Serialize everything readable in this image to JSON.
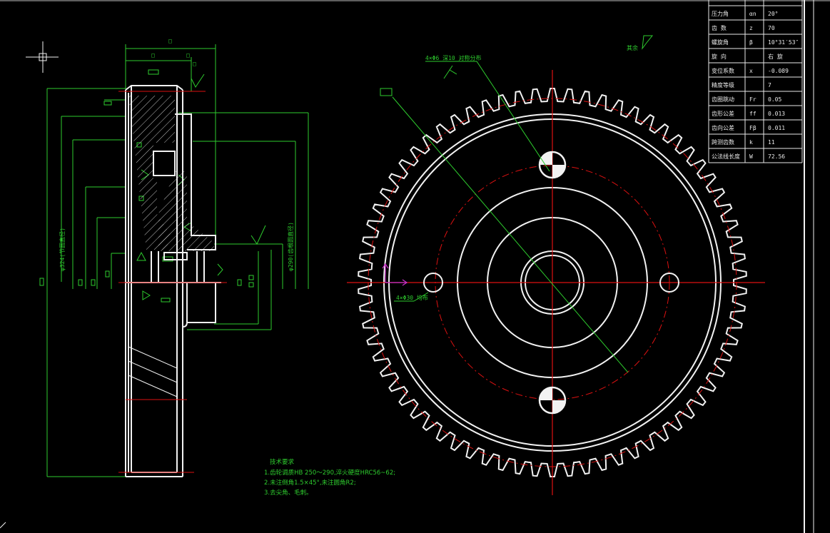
{
  "parameters": [
    {
      "name": "压力角",
      "symbol": "αn",
      "value": "20°"
    },
    {
      "name": "齿 数",
      "symbol": "z",
      "value": "70"
    },
    {
      "name": "螺旋角",
      "symbol": "β",
      "value": "10°31′53″"
    },
    {
      "name": "旋 向",
      "symbol": "",
      "value": "右 旋"
    },
    {
      "name": "变位系数",
      "symbol": "x",
      "value": "-0.089"
    },
    {
      "name": "精度等级",
      "symbol": "",
      "value": "7"
    },
    {
      "name": "齿圈跳动",
      "symbol": "Fr",
      "value": "0.05"
    },
    {
      "name": "齿形公差",
      "symbol": "ff",
      "value": "0.013"
    },
    {
      "name": "齿向公差",
      "symbol": "Fβ",
      "value": "0.011"
    },
    {
      "name": "跨测齿数",
      "symbol": "k",
      "value": "11"
    },
    {
      "name": "公法线长度",
      "symbol": "W",
      "value": "72.56"
    }
  ],
  "notes": {
    "title": "技术要求",
    "items": [
      "1.齿轮调质HB 250～290,淬火硬度HRC56~62;",
      "2.未注倒角1.5×45°,未注圆角R2;",
      "3.去尖角、毛刺。"
    ]
  },
  "labels": {
    "surface_other": "其余",
    "hole_note": "4×Φ30 均布",
    "leader_note": "4×Φ6 深10 对称分布",
    "dim_a": "φ324(节圆直径)",
    "dim_b": "φ290(齿根圆直径)"
  },
  "colors": {
    "green": "#2ecc2e",
    "white": "#f2f2f2",
    "red": "#dd1111",
    "magenta": "#cc33cc"
  },
  "gear": {
    "teeth": 70
  }
}
